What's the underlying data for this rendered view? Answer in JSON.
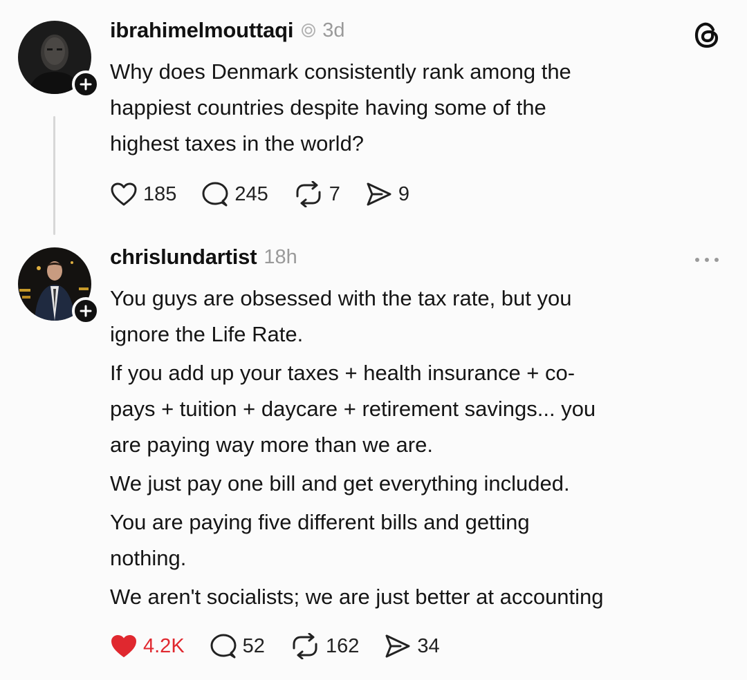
{
  "post": {
    "username": "ibrahimelmouttaqi",
    "time": "3d",
    "lines": [
      "Why does Denmark consistently rank among the",
      "happiest countries despite having some of the",
      "highest taxes in the world?"
    ],
    "likes": "185",
    "replies": "245",
    "reposts": "7",
    "shares": "9",
    "icons": [
      "threads-logo-icon",
      "plus-icon",
      "heart-icon",
      "comment-icon",
      "repost-icon",
      "share-icon"
    ]
  },
  "reply": {
    "username": "chrislundartist",
    "time": "18h",
    "lines": [
      "You guys are obsessed with the tax rate, but you",
      "ignore the Life Rate.",
      "If you add up your taxes + health insurance + co-",
      "pays + tuition + daycare + retirement savings... you",
      "are paying way more than we are.",
      "We just pay one bill and get everything included.",
      "You are paying five different bills and getting",
      "nothing.",
      "We aren't socialists; we are just better at accounting"
    ],
    "likes": "4.2K",
    "replies": "52",
    "reposts": "162",
    "shares": "34",
    "liked_color": "#e0282f",
    "icons": [
      "more-icon",
      "plus-icon",
      "heart-filled-icon",
      "comment-icon",
      "repost-icon",
      "share-icon"
    ]
  }
}
